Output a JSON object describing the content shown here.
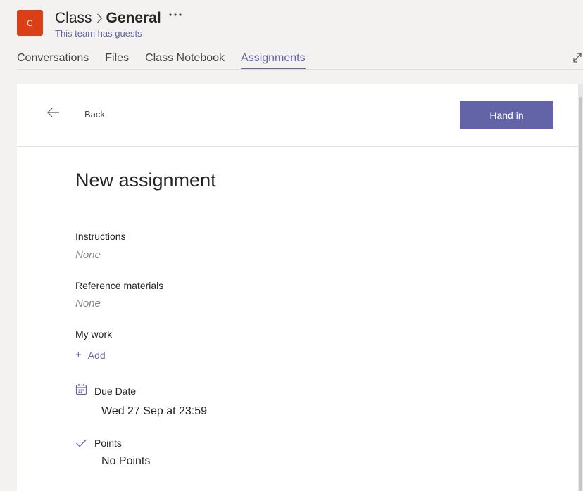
{
  "header": {
    "team_initial": "C",
    "team_name": "Class",
    "channel_name": "General",
    "guest_note": "This team has guests"
  },
  "tabs": [
    {
      "label": "Conversations",
      "active": false
    },
    {
      "label": "Files",
      "active": false
    },
    {
      "label": "Class Notebook",
      "active": false
    },
    {
      "label": "Assignments",
      "active": true
    }
  ],
  "toolbar": {
    "back_label": "Back",
    "hand_in_label": "Hand in"
  },
  "assignment": {
    "title": "New assignment",
    "instructions_label": "Instructions",
    "instructions_value": "None",
    "reference_label": "Reference materials",
    "reference_value": "None",
    "my_work_label": "My work",
    "add_symbol": "+",
    "add_label": "Add",
    "due_date_label": "Due Date",
    "due_date_value": "Wed 27 Sep at 23:59",
    "points_label": "Points",
    "points_value": "No Points"
  },
  "colors": {
    "accent": "#6264a7",
    "team_avatar": "#dc3e15",
    "background": "#f3f2f1"
  },
  "icons": [
    "chevron-right-icon",
    "more-icon",
    "expand-icon",
    "back-arrow-icon",
    "calendar-icon",
    "checkmark-icon"
  ]
}
